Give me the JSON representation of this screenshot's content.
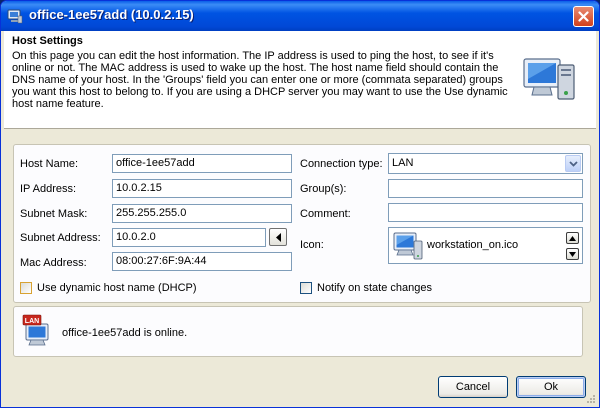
{
  "window": {
    "title": "office-1ee57add (10.0.2.15)"
  },
  "header": {
    "title": "Host Settings",
    "description": "On this page you can edit the host information. The IP address is used to ping the host, to see if it's online or not. The MAC address is used to wake up the host. The host name field should contain the DNS name of your host. In the 'Groups' field you can enter one or more (commata separated) groups you want this host to belong to. If you are using a DHCP server you may want to use the Use dynamic host name feature."
  },
  "form": {
    "host_name": {
      "label": "Host Name:",
      "value": "office-1ee57add"
    },
    "ip_address": {
      "label": "IP Address:",
      "value": "10.0.2.15"
    },
    "subnet_mask": {
      "label": "Subnet Mask:",
      "value": "255.255.255.0"
    },
    "subnet_address": {
      "label": "Subnet Address:",
      "value": "10.0.2.0"
    },
    "mac_address": {
      "label": "Mac Address:",
      "value": "08:00:27:6F:9A:44"
    },
    "connection_type": {
      "label": "Connection type:",
      "value": "LAN"
    },
    "groups": {
      "label": "Group(s):",
      "value": ""
    },
    "comment": {
      "label": "Comment:",
      "value": ""
    },
    "icon": {
      "label": "Icon:",
      "value": "workstation_on.ico"
    },
    "dynamic_host_name": {
      "label": "Use dynamic host name (DHCP)",
      "checked": false
    },
    "notify_state_changes": {
      "label": "Notify on state changes",
      "checked": false
    }
  },
  "status": {
    "badge": "LAN",
    "message": "office-1ee57add is online."
  },
  "buttons": {
    "cancel": "Cancel",
    "ok": "Ok"
  },
  "colors": {
    "titlebar": "#0054e3",
    "window_bg": "#ece9d8",
    "close_button": "#d2401c",
    "field_border": "#7f9db9"
  },
  "icons": {
    "app": "network-computer-icon",
    "header": "monitor-computer-icon",
    "host_icon": "workstation-icon",
    "status": "lan-computer-icon"
  }
}
